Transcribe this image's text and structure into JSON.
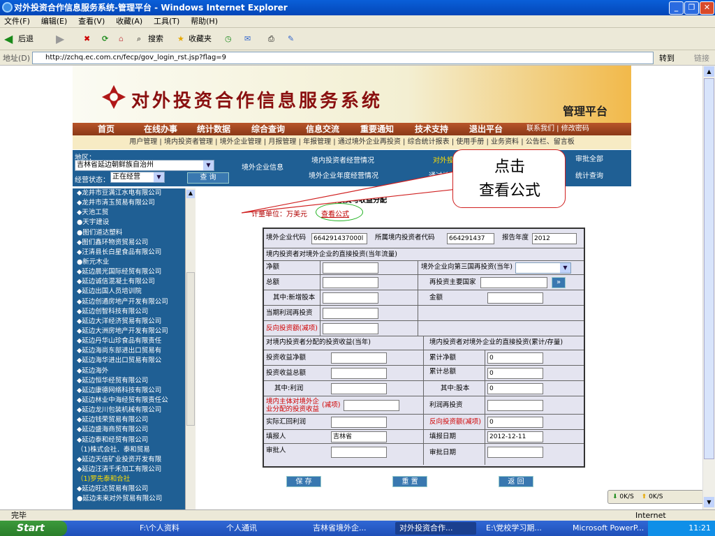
{
  "window": {
    "title": "对外投资合作信息服务系统-管理平台 - Windows Internet Explorer"
  },
  "menu": [
    "文件(F)",
    "编辑(E)",
    "查看(V)",
    "收藏(A)",
    "工具(T)",
    "帮助(H)"
  ],
  "toolbar": {
    "back": "后退",
    "search": "搜索",
    "favorites": "收藏夹"
  },
  "address": {
    "label": "地址(D)",
    "url": "http://zchq.ec.com.cn/fecp/gov_login_rst.jsp?flag=9",
    "go": "转到",
    "links": "链接"
  },
  "site": {
    "title": "对外投资合作信息服务系统",
    "admin": "管理平台",
    "nav": [
      "首页",
      "在线办事",
      "统计数据",
      "综合查询",
      "信息交流",
      "重要通知",
      "技术支持",
      "退出平台"
    ],
    "nav_small": "联系我们 | 修改密码",
    "subnav": "用户管理 | 境内投资者管理 | 境外企业管理 | 月报管理 | 年报管理 | 通过境外企业再投资 | 综合统计报表 | 使用手册 | 业务资料 | 公告栏、留言板",
    "region_label": "地区：",
    "region_value": "吉林省延边朝鲜族自治州",
    "status_label": "经营状态：",
    "status_value": "正在经营",
    "query_btn": "查 询",
    "links": {
      "overseas_info": "境外企业信息",
      "investor_status": "境内投资者经营情况",
      "annual_status": "境外企业年度经营情况",
      "invest_income": "对外投资与收益分配",
      "reinvest": "通过境外企业完成的再投资",
      "approve_all": "审批全部",
      "approve_query": "统计查询"
    }
  },
  "companies": [
    {
      "n": "◆龙井市豆满江水电有限公司",
      "y": false
    },
    {
      "n": "◆龙井市清玉贸易有限公司",
      "y": false
    },
    {
      "n": "◆天池工贸",
      "y": false
    },
    {
      "n": "●天宇建设",
      "y": false
    },
    {
      "n": "●图们道达塑料",
      "y": false
    },
    {
      "n": "◆图们鑫环物资贸易公司",
      "y": false
    },
    {
      "n": "◆汪清县长白星食品有限公司",
      "y": false
    },
    {
      "n": "●新元木业",
      "y": false
    },
    {
      "n": "◆延边晨光国际经贸有限公司",
      "y": false
    },
    {
      "n": "◆延边诚信混凝土有限公司",
      "y": false
    },
    {
      "n": "◆延边出国人员培训院",
      "y": false
    },
    {
      "n": "◆延边创通房地产开发有限公司",
      "y": false
    },
    {
      "n": "◆延边创智科技有限公司",
      "y": false
    },
    {
      "n": "◆延边大洋经济贸易有限公司",
      "y": false
    },
    {
      "n": "◆延边大洲房地产开发有限公司",
      "y": false
    },
    {
      "n": "◆延边丹华山珍食品有限责任",
      "y": false
    },
    {
      "n": "◆延边海尚东部进出口贸易有",
      "y": false
    },
    {
      "n": "◆延边海华进出口贸易有限公",
      "y": false
    },
    {
      "n": "◆延边海外",
      "y": false
    },
    {
      "n": "◆延边恒华经贸有限公司",
      "y": false
    },
    {
      "n": "◆延边康德网络科技有限公司",
      "y": false
    },
    {
      "n": "◆延边林业中海经贸有限责任公",
      "y": false
    },
    {
      "n": "◆延边龙川包装机械有限公司",
      "y": false
    },
    {
      "n": "◆延边钱荣贸易有限公司",
      "y": false
    },
    {
      "n": "◆延边盛海商贸有限公司",
      "y": false
    },
    {
      "n": "◆延边泰和经贸有限公司",
      "y": false
    },
    {
      "n": "（1)株式会社．泰和贸易",
      "y": false
    },
    {
      "n": "◆延边天信矿业投资开发有限",
      "y": false
    },
    {
      "n": "◆延边汪清千禾加工有限公司",
      "y": false
    },
    {
      "n": "（1)罗先泰和合社",
      "y": true
    },
    {
      "n": "◆延边旺达贸易有限公司",
      "y": false
    },
    {
      "n": "●延边未来对外贸易有限公司",
      "y": false
    }
  ],
  "form": {
    "title": "对外投资与收益分配",
    "unit": "计量单位：万美元",
    "formula_link": "查看公式",
    "code_label": "境外企业代码",
    "code_value": "664291437000l",
    "investor_code_label": "所属境内投资者代码",
    "investor_code_value": "664291437",
    "year_label": "报告年度",
    "year_value": "2012",
    "sec1": "境内投资者对境外企业的直接投资(当年流量)",
    "net": "净额",
    "third_party": "境外企业向第三国再投资(当年)",
    "total": "总额",
    "main_country": "再投资主要国家",
    "new_equity": "其中:新增股本",
    "amount": "金额",
    "profit_reinvest": "当期利润再投资",
    "reverse_invest": "反向投资额(减项)",
    "sec2": "对境内投资者分配的投资收益(当年)",
    "sec3": "境内投资者对境外企业的直接投资(累计/存量)",
    "income_net": "投资收益净额",
    "cum_net": "累计净额",
    "cum_net_value": "0",
    "income_total": "投资收益总额",
    "cum_total": "累计总额",
    "cum_total_value": "0",
    "of_profit": "其中:利润",
    "of_equity": "其中:股本",
    "of_equity_value": "0",
    "domestic_income": "境内主体对境外企业分配的投资收益",
    "deduct": "(减项)",
    "profit_reinvest2": "利润再投资",
    "remitted": "实际汇回利润",
    "reverse2": "反向投资额(减项)",
    "reverse2_value": "0",
    "filler": "填报人",
    "filler_value": "吉林省",
    "fill_date": "填报日期",
    "fill_date_value": "2012-12-11",
    "approver": "审批人",
    "approve_date": "审批日期",
    "save": "保 存",
    "reset": "重 置",
    "back": "返 回"
  },
  "callout": {
    "text": "点击\n查看公式"
  },
  "network": {
    "down": "0K/S",
    "up": "0K/S"
  },
  "status": {
    "text": "完毕",
    "zone": "Internet"
  },
  "taskbar": {
    "start": "Start",
    "tasks": [
      "F:\\个人资料",
      "个人通讯",
      "吉林省境外企...",
      "对外投资合作...",
      "E:\\党校学习期...",
      "Microsoft PowerP..."
    ],
    "clock": "11:21"
  }
}
